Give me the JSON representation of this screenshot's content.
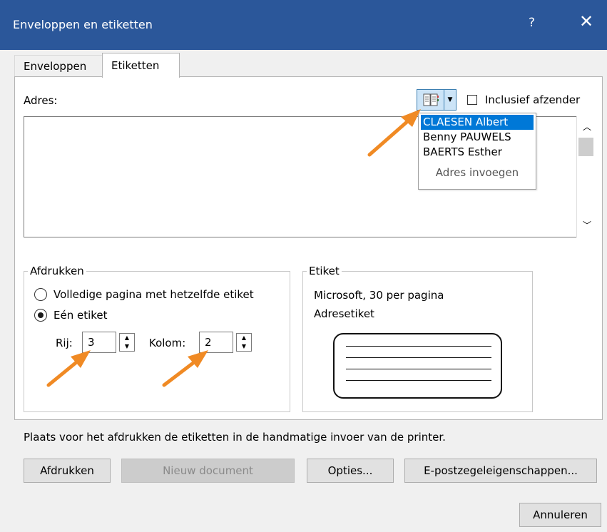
{
  "window": {
    "title": "Enveloppen en etiketten",
    "help_label": "?",
    "close_label": "✕"
  },
  "tabs": [
    {
      "label": "Enveloppen"
    },
    {
      "label": "Etiketten"
    }
  ],
  "address": {
    "label": "Adres:",
    "include_sender_label": "Inclusief afzender",
    "dropdown": {
      "items": [
        "CLAESEN Albert",
        "Benny PAUWELS",
        "BAERTS Esther"
      ],
      "selected_index": 0,
      "insert_label": "Adres invoegen"
    }
  },
  "print": {
    "group_label": "Afdrukken",
    "full_page_label": "Volledige pagina met hetzelfde etiket",
    "single_label": "Eén etiket",
    "selected": "single",
    "row_label": "Rij:",
    "row_value": "3",
    "column_label": "Kolom:",
    "column_value": "2"
  },
  "label": {
    "group_label": "Etiket",
    "line1": "Microsoft, 30 per pagina",
    "line2": "Adresetiket"
  },
  "instruction": "Plaats voor het afdrukken de etiketten in de handmatige invoer van de printer.",
  "buttons": {
    "print": "Afdrukken",
    "new_document": "Nieuw document",
    "options": "Opties...",
    "epostage": "E-postzegeleigenschappen...",
    "cancel": "Annuleren"
  },
  "colors": {
    "titlebar": "#2b579a",
    "selection": "#0078d7",
    "annotation_arrow": "#f08a24"
  }
}
